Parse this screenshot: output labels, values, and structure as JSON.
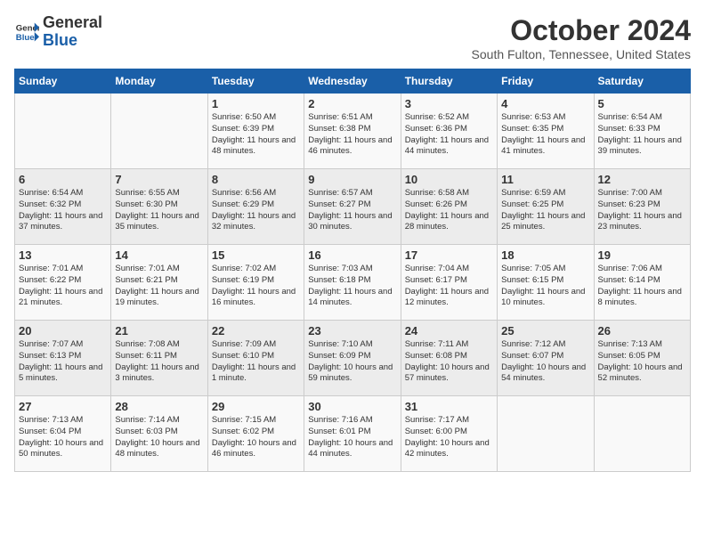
{
  "header": {
    "logo_line1": "General",
    "logo_line2": "Blue",
    "month": "October 2024",
    "location": "South Fulton, Tennessee, United States"
  },
  "days_of_week": [
    "Sunday",
    "Monday",
    "Tuesday",
    "Wednesday",
    "Thursday",
    "Friday",
    "Saturday"
  ],
  "weeks": [
    [
      {
        "day": "",
        "info": ""
      },
      {
        "day": "",
        "info": ""
      },
      {
        "day": "1",
        "info": "Sunrise: 6:50 AM\nSunset: 6:39 PM\nDaylight: 11 hours and 48 minutes."
      },
      {
        "day": "2",
        "info": "Sunrise: 6:51 AM\nSunset: 6:38 PM\nDaylight: 11 hours and 46 minutes."
      },
      {
        "day": "3",
        "info": "Sunrise: 6:52 AM\nSunset: 6:36 PM\nDaylight: 11 hours and 44 minutes."
      },
      {
        "day": "4",
        "info": "Sunrise: 6:53 AM\nSunset: 6:35 PM\nDaylight: 11 hours and 41 minutes."
      },
      {
        "day": "5",
        "info": "Sunrise: 6:54 AM\nSunset: 6:33 PM\nDaylight: 11 hours and 39 minutes."
      }
    ],
    [
      {
        "day": "6",
        "info": "Sunrise: 6:54 AM\nSunset: 6:32 PM\nDaylight: 11 hours and 37 minutes."
      },
      {
        "day": "7",
        "info": "Sunrise: 6:55 AM\nSunset: 6:30 PM\nDaylight: 11 hours and 35 minutes."
      },
      {
        "day": "8",
        "info": "Sunrise: 6:56 AM\nSunset: 6:29 PM\nDaylight: 11 hours and 32 minutes."
      },
      {
        "day": "9",
        "info": "Sunrise: 6:57 AM\nSunset: 6:27 PM\nDaylight: 11 hours and 30 minutes."
      },
      {
        "day": "10",
        "info": "Sunrise: 6:58 AM\nSunset: 6:26 PM\nDaylight: 11 hours and 28 minutes."
      },
      {
        "day": "11",
        "info": "Sunrise: 6:59 AM\nSunset: 6:25 PM\nDaylight: 11 hours and 25 minutes."
      },
      {
        "day": "12",
        "info": "Sunrise: 7:00 AM\nSunset: 6:23 PM\nDaylight: 11 hours and 23 minutes."
      }
    ],
    [
      {
        "day": "13",
        "info": "Sunrise: 7:01 AM\nSunset: 6:22 PM\nDaylight: 11 hours and 21 minutes."
      },
      {
        "day": "14",
        "info": "Sunrise: 7:01 AM\nSunset: 6:21 PM\nDaylight: 11 hours and 19 minutes."
      },
      {
        "day": "15",
        "info": "Sunrise: 7:02 AM\nSunset: 6:19 PM\nDaylight: 11 hours and 16 minutes."
      },
      {
        "day": "16",
        "info": "Sunrise: 7:03 AM\nSunset: 6:18 PM\nDaylight: 11 hours and 14 minutes."
      },
      {
        "day": "17",
        "info": "Sunrise: 7:04 AM\nSunset: 6:17 PM\nDaylight: 11 hours and 12 minutes."
      },
      {
        "day": "18",
        "info": "Sunrise: 7:05 AM\nSunset: 6:15 PM\nDaylight: 11 hours and 10 minutes."
      },
      {
        "day": "19",
        "info": "Sunrise: 7:06 AM\nSunset: 6:14 PM\nDaylight: 11 hours and 8 minutes."
      }
    ],
    [
      {
        "day": "20",
        "info": "Sunrise: 7:07 AM\nSunset: 6:13 PM\nDaylight: 11 hours and 5 minutes."
      },
      {
        "day": "21",
        "info": "Sunrise: 7:08 AM\nSunset: 6:11 PM\nDaylight: 11 hours and 3 minutes."
      },
      {
        "day": "22",
        "info": "Sunrise: 7:09 AM\nSunset: 6:10 PM\nDaylight: 11 hours and 1 minute."
      },
      {
        "day": "23",
        "info": "Sunrise: 7:10 AM\nSunset: 6:09 PM\nDaylight: 10 hours and 59 minutes."
      },
      {
        "day": "24",
        "info": "Sunrise: 7:11 AM\nSunset: 6:08 PM\nDaylight: 10 hours and 57 minutes."
      },
      {
        "day": "25",
        "info": "Sunrise: 7:12 AM\nSunset: 6:07 PM\nDaylight: 10 hours and 54 minutes."
      },
      {
        "day": "26",
        "info": "Sunrise: 7:13 AM\nSunset: 6:05 PM\nDaylight: 10 hours and 52 minutes."
      }
    ],
    [
      {
        "day": "27",
        "info": "Sunrise: 7:13 AM\nSunset: 6:04 PM\nDaylight: 10 hours and 50 minutes."
      },
      {
        "day": "28",
        "info": "Sunrise: 7:14 AM\nSunset: 6:03 PM\nDaylight: 10 hours and 48 minutes."
      },
      {
        "day": "29",
        "info": "Sunrise: 7:15 AM\nSunset: 6:02 PM\nDaylight: 10 hours and 46 minutes."
      },
      {
        "day": "30",
        "info": "Sunrise: 7:16 AM\nSunset: 6:01 PM\nDaylight: 10 hours and 44 minutes."
      },
      {
        "day": "31",
        "info": "Sunrise: 7:17 AM\nSunset: 6:00 PM\nDaylight: 10 hours and 42 minutes."
      },
      {
        "day": "",
        "info": ""
      },
      {
        "day": "",
        "info": ""
      }
    ]
  ]
}
